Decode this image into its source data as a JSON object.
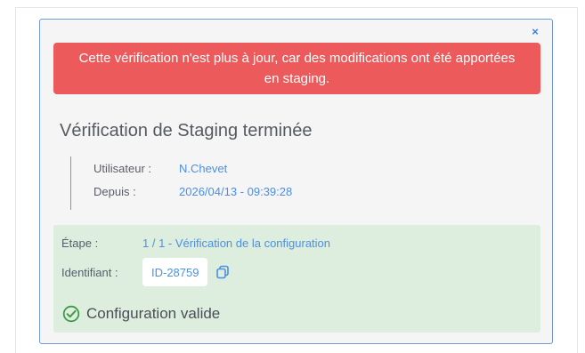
{
  "modal": {
    "close_label": "×",
    "alert": "Cette vérification n'est plus à jour, car des modifications ont été apportées en staging.",
    "title": "Vérification de Staging terminée",
    "info": {
      "user_label": "Utilisateur :",
      "user_value": "N.Chevet",
      "since_label": "Depuis :",
      "since_value": "2026/04/13 - 09:39:28"
    },
    "result": {
      "stage_label": "Étape :",
      "stage_value": "1 / 1 - Vérification de la configuration",
      "id_label": "Identifiant :",
      "id_value": "ID-28759",
      "status_text": "Configuration valide"
    }
  },
  "colors": {
    "alert_bg": "#ec5a5b",
    "accent": "#4c8fe3",
    "success_bg": "#ddeedf",
    "success_icon": "#3f9a46"
  },
  "icons": {
    "close": "close-icon",
    "copy": "copy-icon",
    "status": "check-circle-icon"
  }
}
